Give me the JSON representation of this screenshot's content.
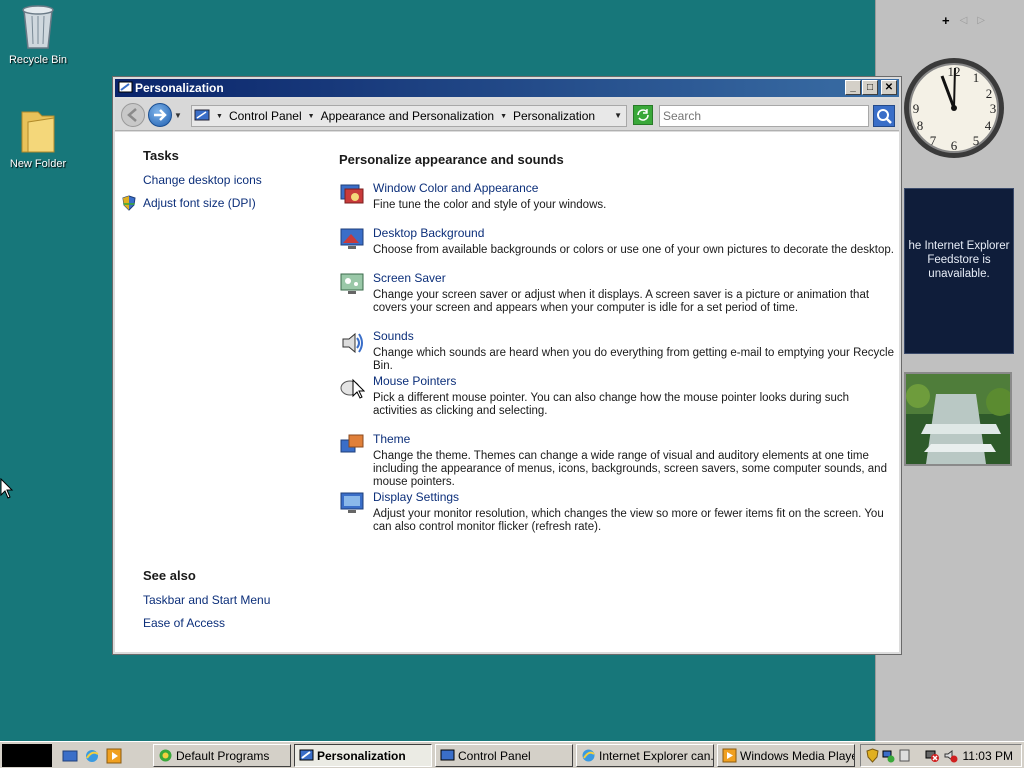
{
  "desktop": {
    "icons": [
      {
        "label": "Recycle Bin"
      },
      {
        "label": "New Folder"
      }
    ]
  },
  "sidebar": {
    "add_label": "+",
    "prev_label": "◁",
    "next_label": "▷",
    "feed_message": "he Internet Explorer Feedstore is unavailable."
  },
  "window": {
    "title": "Personalization",
    "buttons": {
      "minimize": "_",
      "maximize": "□",
      "close": "✕"
    },
    "breadcrumb": [
      "Control Panel",
      "Appearance and Personalization",
      "Personalization"
    ],
    "search_placeholder": "Search",
    "tasks": {
      "heading": "Tasks",
      "items": [
        "Change desktop icons",
        "Adjust font size (DPI)"
      ]
    },
    "see_also": {
      "heading": "See also",
      "items": [
        "Taskbar and Start Menu",
        "Ease of Access"
      ]
    },
    "main": {
      "title": "Personalize appearance and sounds",
      "items": [
        {
          "title": "Window Color and Appearance",
          "desc": "Fine tune the color and style of your windows."
        },
        {
          "title": "Desktop Background",
          "desc": "Choose from available backgrounds or colors or use one of your own pictures to decorate the desktop."
        },
        {
          "title": "Screen Saver",
          "desc": "Change your screen saver or adjust when it displays. A screen saver is a picture or animation that covers your screen and appears when your computer is idle for a set period of time."
        },
        {
          "title": "Sounds",
          "desc": "Change which sounds are heard when you do everything from getting e-mail to emptying your Recycle Bin."
        },
        {
          "title": "Mouse Pointers",
          "desc": "Pick a different mouse pointer. You can also change how the mouse pointer looks during such activities as clicking and selecting."
        },
        {
          "title": "Theme",
          "desc": "Change the theme. Themes can change a wide range of visual and auditory elements at one time including the appearance of menus, icons, backgrounds, screen savers, some computer sounds, and mouse pointers."
        },
        {
          "title": "Display Settings",
          "desc": "Adjust your monitor resolution, which changes the view so more or fewer items fit on the screen. You can also control monitor flicker (refresh rate)."
        }
      ]
    }
  },
  "taskbar": {
    "tasks": [
      {
        "label": "Default Programs",
        "active": false
      },
      {
        "label": "Personalization",
        "active": true
      },
      {
        "label": "Control Panel",
        "active": false
      },
      {
        "label": "Internet Explorer can...",
        "active": false
      },
      {
        "label": "Windows Media Player",
        "active": false
      }
    ],
    "clock": "11:03 PM"
  },
  "colors": {
    "desktop": "#17777a",
    "link": "#0c2f7a",
    "titlebar": "#0a246a"
  }
}
